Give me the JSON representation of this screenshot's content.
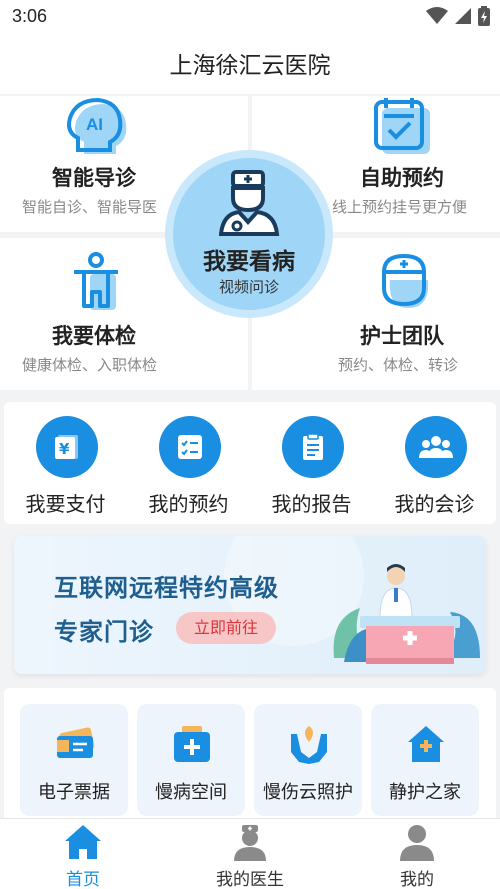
{
  "status_bar": {
    "time": "3:06"
  },
  "header": {
    "title": "上海徐汇云医院"
  },
  "features": [
    {
      "title": "智能导诊",
      "subtitle": "智能自诊、智能导医",
      "icon": "ai-head-icon"
    },
    {
      "title": "自助预约",
      "subtitle": "线上预约挂号更方便",
      "icon": "calendar-check-icon"
    },
    {
      "title": "我要体检",
      "subtitle": "健康体检、入职体检",
      "icon": "person-exam-icon"
    },
    {
      "title": "护士团队",
      "subtitle": "预约、体检、转诊",
      "icon": "nurse-icon"
    }
  ],
  "center_action": {
    "title": "我要看病",
    "subtitle": "视频问诊",
    "icon": "doctor-icon"
  },
  "quick_actions": [
    {
      "label": "我要支付",
      "icon": "yuan-payment-icon"
    },
    {
      "label": "我的预约",
      "icon": "checklist-icon"
    },
    {
      "label": "我的报告",
      "icon": "report-clipboard-icon"
    },
    {
      "label": "我的会诊",
      "icon": "group-consult-icon"
    }
  ],
  "banner": {
    "line1": "互联网远程特约高级",
    "line2": "专家门诊",
    "button": "立即前往"
  },
  "services": [
    {
      "label": "电子票据",
      "icon": "e-ticket-icon"
    },
    {
      "label": "慢病空间",
      "icon": "medical-kit-icon"
    },
    {
      "label": "慢伤云照护",
      "icon": "care-hands-icon"
    },
    {
      "label": "静护之家",
      "icon": "home-plus-icon"
    }
  ],
  "tabbar": {
    "items": [
      {
        "label": "首页",
        "icon": "home-icon",
        "active": true
      },
      {
        "label": "我的医生",
        "icon": "doctor-tab-icon",
        "active": false
      },
      {
        "label": "我的",
        "icon": "user-icon",
        "active": false
      }
    ]
  },
  "colors": {
    "primary": "#1a8ee0",
    "light_blue": "#9fd5f6",
    "banner_text": "#1f5f8f",
    "banner_button": "#d9363e"
  }
}
